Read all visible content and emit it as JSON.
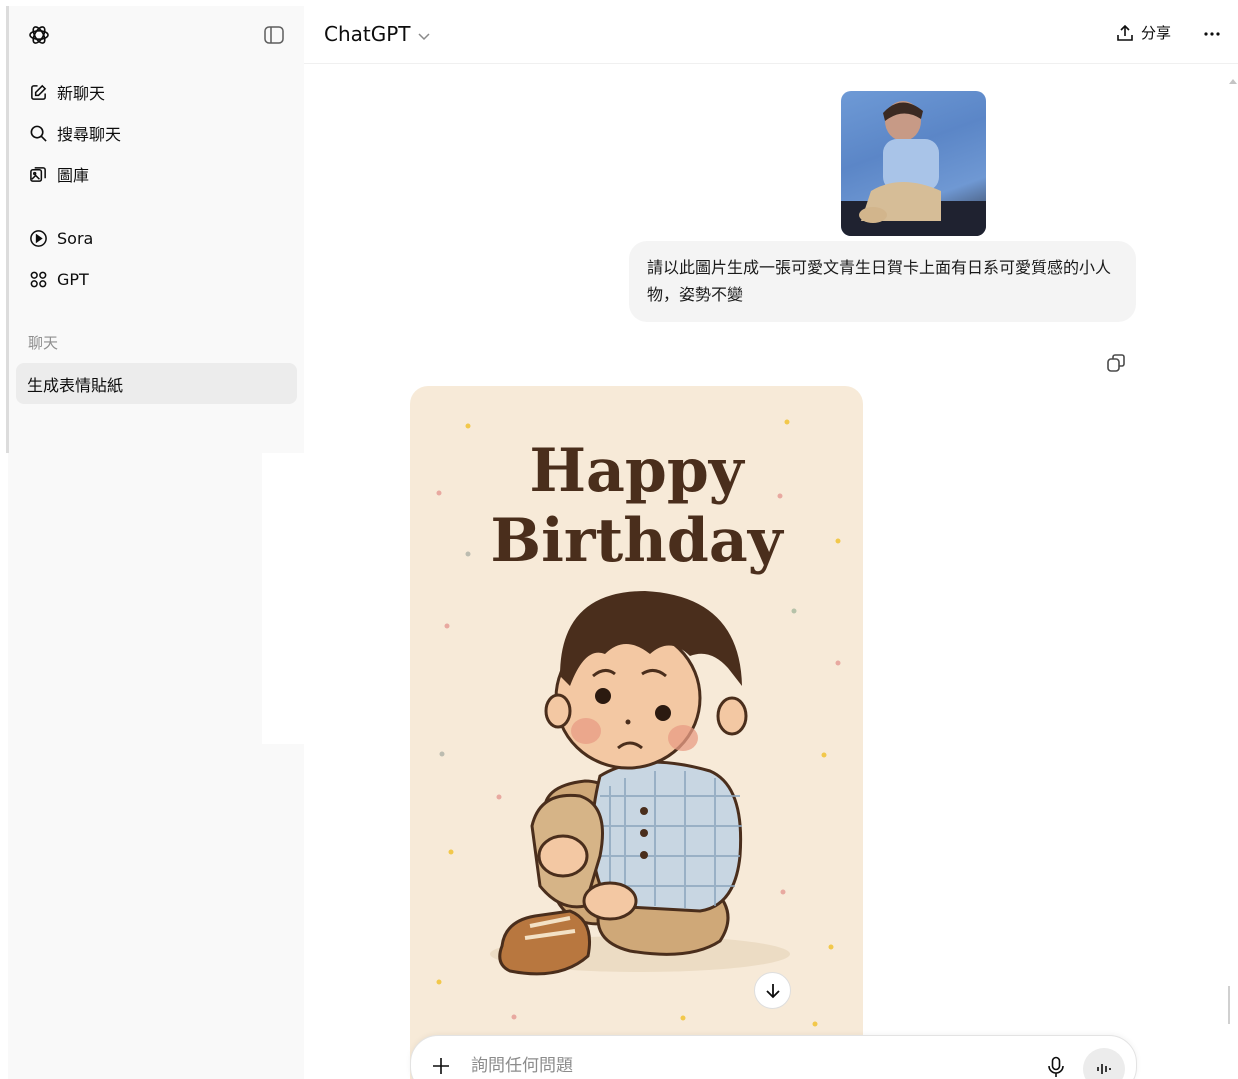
{
  "sidebar": {
    "new_chat": "新聊天",
    "search_chats": "搜尋聊天",
    "library": "圖庫",
    "sora": "Sora",
    "gpt": "GPT",
    "section_chats": "聊天",
    "chat_items": [
      "生成表情貼紙"
    ]
  },
  "header": {
    "model": "ChatGPT",
    "share": "分享"
  },
  "conversation": {
    "user_message": "請以此圖片生成一張可愛文青生日賀卡上面有日系可愛質感的小人物，姿勢不變",
    "card_title_line1": "Happy",
    "card_title_line2": "Birthday"
  },
  "composer": {
    "placeholder": "詢問任何問題"
  },
  "colors": {
    "sidebar_bg": "#f9f9f9",
    "card_bg": "#f7ead8",
    "card_title": "#4a2e1c",
    "bubble_bg": "#f4f4f4"
  }
}
